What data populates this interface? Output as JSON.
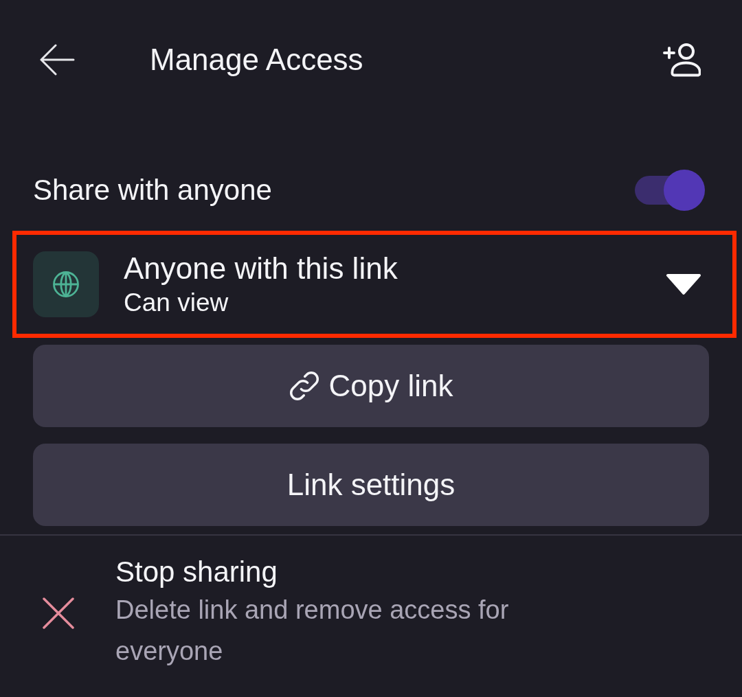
{
  "header": {
    "title": "Manage Access"
  },
  "share_toggle": {
    "label": "Share with anyone",
    "on": true
  },
  "link_access": {
    "title": "Anyone with this link",
    "permission": "Can view",
    "highlighted": true
  },
  "buttons": [
    {
      "label": "Copy link",
      "kind": "copy"
    },
    {
      "label": "Link settings",
      "kind": "plain"
    }
  ],
  "stop_sharing": {
    "title": "Stop sharing",
    "description": "Delete link and remove access for everyone"
  }
}
